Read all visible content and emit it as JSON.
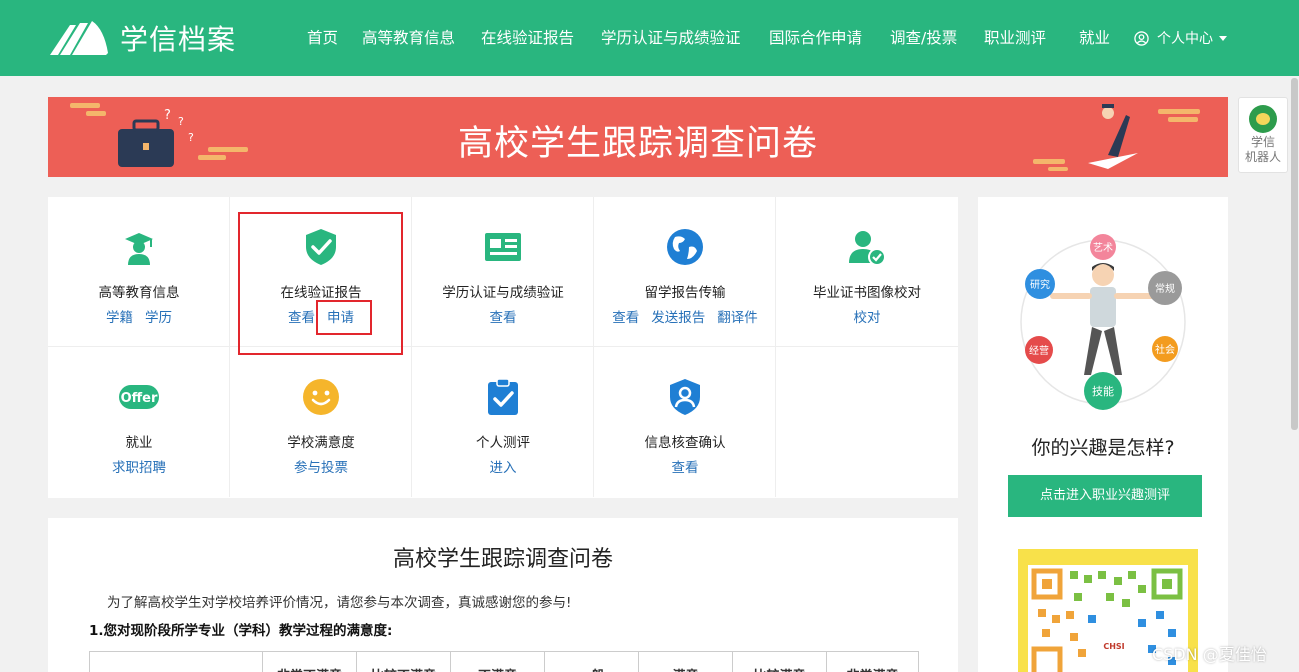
{
  "header": {
    "logo_text": "学信档案",
    "nav": [
      "首页",
      "高等教育信息",
      "在线验证报告",
      "学历认证与成绩验证",
      "国际合作申请",
      "调查/投票",
      "职业测评",
      "就业"
    ],
    "user_menu": "个人中心"
  },
  "banner": {
    "title": "高校学生跟踪调查问卷"
  },
  "robot": {
    "label_1": "学信",
    "label_2": "机器人"
  },
  "services": [
    {
      "title": "高等教育信息",
      "icon": "graduate-icon",
      "links": [
        "学籍",
        "学历"
      ]
    },
    {
      "title": "在线验证报告",
      "icon": "shield-check-icon",
      "links": [
        "查看",
        "申请"
      ]
    },
    {
      "title": "学历认证与成绩验证",
      "icon": "certificate-card-icon",
      "links": [
        "查看"
      ]
    },
    {
      "title": "留学报告传输",
      "icon": "globe-icon",
      "links": [
        "查看",
        "发送报告",
        "翻译件"
      ]
    },
    {
      "title": "毕业证书图像校对",
      "icon": "user-check-icon",
      "links": [
        "校对"
      ]
    },
    {
      "title": "就业",
      "icon": "offer-icon",
      "links": [
        "求职招聘"
      ]
    },
    {
      "title": "学校满意度",
      "icon": "smiley-icon",
      "links": [
        "参与投票"
      ]
    },
    {
      "title": "个人测评",
      "icon": "clipboard-check-icon",
      "links": [
        "进入"
      ]
    },
    {
      "title": "信息核查确认",
      "icon": "user-shield-icon",
      "links": [
        "查看"
      ]
    }
  ],
  "interest": {
    "tags": [
      "艺术",
      "研究",
      "常规",
      "经营",
      "社会",
      "技能"
    ],
    "question": "你的兴趣是怎样?",
    "button": "点击进入职业兴趣测评",
    "qr_brand": "CHSI"
  },
  "survey": {
    "title": "高校学生跟踪调查问卷",
    "intro": "为了解高校学生对学校培养评价情况，请您参与本次调查，真诚感谢您的参与!",
    "question_1": "1.您对现阶段所学专业（学科）教学过程的满意度:",
    "columns": [
      "非常不满意",
      "比较不满意",
      "不满意",
      "一般",
      "满意",
      "比较满意",
      "非常满意"
    ]
  },
  "watermark": "CSDN @夏佳怡",
  "colors": {
    "brand_green": "#29b67f",
    "banner_red": "#ed5f56",
    "link_blue": "#2871b8",
    "highlight_red": "#e2262d"
  }
}
